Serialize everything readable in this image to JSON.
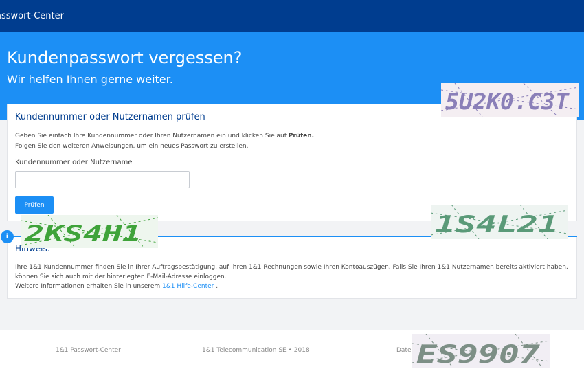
{
  "header": {
    "brand": "asswort-Center"
  },
  "hero": {
    "title": "Kundenpasswort vergessen?",
    "subtitle": "Wir helfen Ihnen gerne weiter."
  },
  "check_card": {
    "title": "Kundennummer oder Nutzernamen prüfen",
    "desc_prefix": "Geben Sie einfach Ihre Kundennummer oder Ihren Nutzernamen ein und klicken Sie auf ",
    "desc_bold": "Prüfen.",
    "desc_line2": "Folgen Sie den weiteren Anweisungen, um ein neues Passwort zu erstellen.",
    "field_label": "Kundennummer oder Nutzername",
    "field_value": "",
    "button_label": "Prüfen"
  },
  "hint_card": {
    "title": "Hinweis:",
    "line1": "Ihre 1&1 Kundennummer finden Sie in Ihrer Auftragsbestätigung, auf Ihren 1&1 Rechnungen sowie Ihren Kontoauszügen. Falls Sie Ihren 1&1 Nutzernamen bereits aktiviert haben, können Sie sich auch mit der hinterlegten E-Mail-Adresse einloggen.",
    "line2_prefix": "Weitere Informationen erhalten Sie in unserem ",
    "link_text": "1&1 Hilfe-Center",
    "line2_suffix": " .",
    "info_icon_glyph": "i"
  },
  "footer": {
    "left": "1&1 Passwort-Center",
    "center": "1&1 Telecommunication SE • 2018",
    "right": "Date"
  },
  "captchas": [
    {
      "text": "5U2K0.C3T",
      "color": "#8a7fb8",
      "bg": "#f4eef2"
    },
    {
      "text": "2KS4H1",
      "color": "#3fa33a",
      "bg": "#eef6ee"
    },
    {
      "text": "1S4L21",
      "color": "#5a9a78",
      "bg": "#eef4f1"
    },
    {
      "text": "ES9907",
      "color": "#7d8f86",
      "bg": "#f1eef4"
    }
  ],
  "colors": {
    "topbar": "#003d8f",
    "accent": "#1c8ff5",
    "page_bg": "#f2f3f5"
  }
}
